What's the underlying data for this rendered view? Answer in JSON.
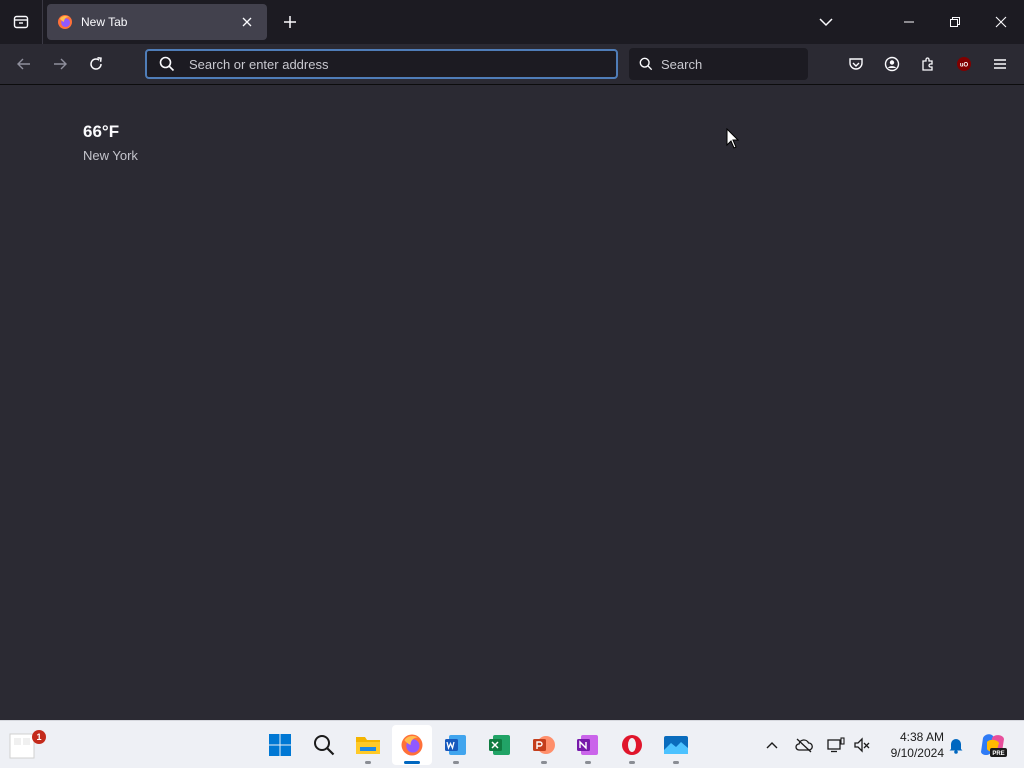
{
  "browser": {
    "tab": {
      "title": "New Tab"
    },
    "urlbar": {
      "placeholder": "Search or enter address"
    },
    "searchbar": {
      "placeholder": "Search"
    },
    "extensions": {
      "ublock_label": "uO"
    }
  },
  "content": {
    "weather": {
      "temperature": "66°F",
      "location": "New York"
    }
  },
  "taskbar": {
    "widget_badge": "1",
    "apps": [
      {
        "name": "start-button"
      },
      {
        "name": "search"
      },
      {
        "name": "file-explorer"
      },
      {
        "name": "firefox",
        "active": true
      },
      {
        "name": "word"
      },
      {
        "name": "excel"
      },
      {
        "name": "powerpoint"
      },
      {
        "name": "onenote"
      },
      {
        "name": "opera"
      },
      {
        "name": "photos"
      }
    ],
    "clock": {
      "time": "4:38 AM",
      "date": "9/10/2024"
    },
    "copilot_label": "PRE"
  },
  "colors": {
    "accent": "#0067c0",
    "urlbar_focus": "#4f7db8",
    "toolbar_bg": "#2b2a33",
    "tabstrip_bg": "#1c1b22"
  }
}
